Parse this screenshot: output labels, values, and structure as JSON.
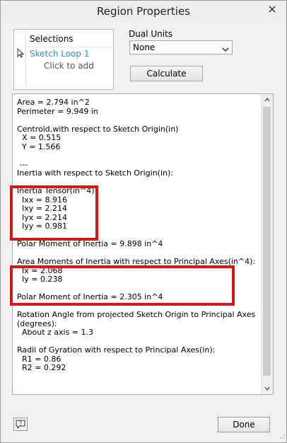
{
  "window": {
    "title": "Region Properties"
  },
  "selections": {
    "header": "Selections",
    "items": [
      "Sketch Loop 1"
    ],
    "add_label": "Click to add"
  },
  "dual_units": {
    "label": "Dual Units",
    "value": "None"
  },
  "calculate_label": "Calculate",
  "results": {
    "lines": [
      "Area = 2.794 in^2",
      "Perimeter = 9.949 in",
      "",
      "Centroid,with respect to Sketch Origin(in)",
      "  X = 0.515",
      "  Y = 1.566",
      "",
      " ---",
      "Inertia with respect to Sketch Origin(in):",
      "",
      "Inertia Tensor(in^4)",
      "  Ixx = 8.916",
      "  Ixy = 2.214",
      "  Iyx = 2.214",
      "  Iyy = 0.981",
      "",
      "Polar Moment of Inertia = 9.898 in^4",
      "",
      "Area Moments of Inertia with respect to Principal Axes(in^4):",
      "  Ix = 2.068",
      "  Iy = 0.238",
      "",
      "Polar Moment of Inertia = 2.305 in^4",
      "",
      "Rotation Angle from projected Sketch Origin to Principal Axes",
      "(degrees):",
      "  About z axis = 1.3",
      "",
      "Radii of Gyration with respect to Principal Axes(in):",
      "  R1 = 0.86",
      "  R2 = 0.292"
    ]
  },
  "footer": {
    "help_icon": "help-icon",
    "done_label": "Done"
  },
  "colors": {
    "highlight_box": "#d21a1a",
    "selection_link": "#2a8fd6"
  }
}
